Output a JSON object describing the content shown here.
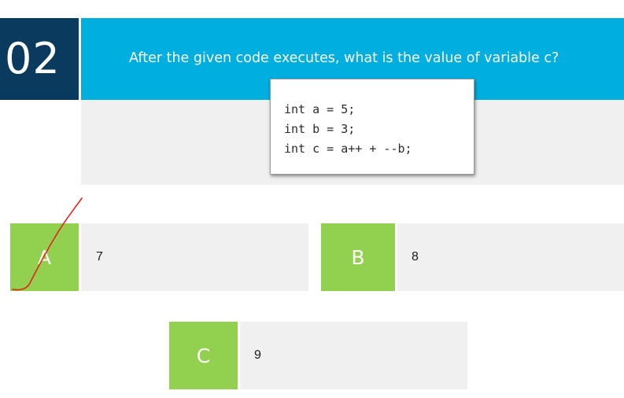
{
  "question": {
    "number": "02",
    "text": "After the given code executes, what is the value of variable c?",
    "code": "int a = 5;\nint b = 3;\nint c = a++ + --b;"
  },
  "options": [
    {
      "letter": "A",
      "value": "7",
      "marked": true
    },
    {
      "letter": "B",
      "value": "8",
      "marked": false
    },
    {
      "letter": "C",
      "value": "9",
      "marked": false
    }
  ],
  "colors": {
    "number_bg": "#0a3a5e",
    "header_bg": "#00aee0",
    "option_letter_bg": "#92d050",
    "panel_bg": "#f0f0f0",
    "mark": "#e8211a"
  }
}
